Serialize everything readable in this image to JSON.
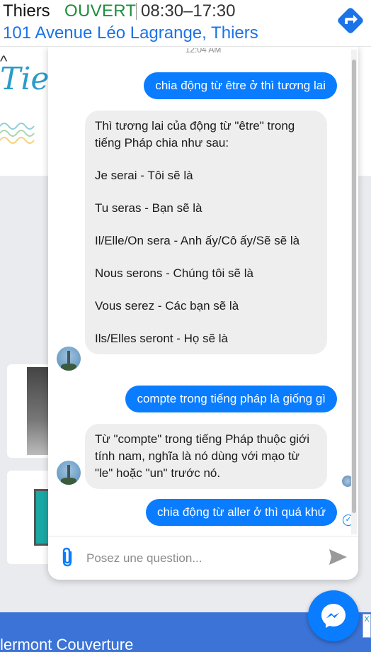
{
  "topbar": {
    "name": "Thiers",
    "status": "OUVERT",
    "hours": "08:30–17:30",
    "address": "101 Avenue Léo Lagrange, Thiers"
  },
  "background": {
    "close_glyph": "^",
    "logo_text": "Tier",
    "footer_text": "lermont Couverture",
    "ad_badge": "X"
  },
  "chat": {
    "timestamp": "12:04 AM",
    "messages": [
      {
        "role": "user",
        "text": "chia động từ être ở thì tương lai"
      },
      {
        "role": "bot",
        "lines": [
          "Thì tương lai của động từ \"être\" trong tiếng Pháp chia như sau:",
          "Je serai - Tôi sẽ là",
          "Tu seras - Bạn sẽ là",
          "Il/Elle/On sera - Anh ấy/Cô ấy/Sẽ sẽ là",
          "Nous serons - Chúng tôi sẽ là",
          "Vous serez - Các bạn sẽ là",
          "Ils/Elles seront - Họ sẽ là"
        ]
      },
      {
        "role": "user",
        "text": "compte trong tiếng pháp là giống gì"
      },
      {
        "role": "bot",
        "lines": [
          "Từ \"compte\" trong tiếng Pháp thuộc giới tính nam, nghĩa là nó dùng với mạo từ \"le\" hoặc \"un\" trước nó."
        ]
      },
      {
        "role": "user",
        "text": "chia động từ aller ở thì quá khứ"
      }
    ],
    "sent_check": "✓",
    "input_placeholder": "Posez une question..."
  },
  "icons": {
    "directions": "directions-icon",
    "attach": "paperclip-icon",
    "send": "send-icon",
    "messenger": "messenger-icon"
  },
  "colors": {
    "accent": "#0a7cff",
    "status_open": "#1e8e3e",
    "link": "#1a73e8"
  }
}
